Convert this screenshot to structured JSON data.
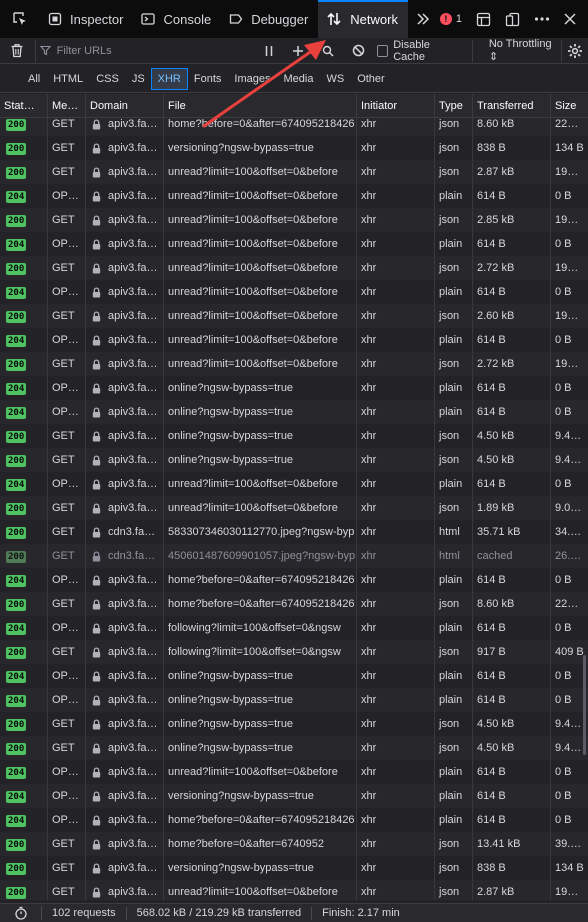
{
  "toolbar": {
    "tabs": [
      {
        "label": "Inspector",
        "icon": "inspector-icon"
      },
      {
        "label": "Console",
        "icon": "console-icon"
      },
      {
        "label": "Debugger",
        "icon": "debugger-icon"
      },
      {
        "label": "Network",
        "icon": "network-icon"
      }
    ],
    "active_tab": "Network",
    "error_count": "1",
    "accent": "#0a84ff"
  },
  "filterbar": {
    "filter_placeholder": "Filter URLs",
    "disable_cache_label": "Disable Cache",
    "throttling_label": "No Throttling ⇕"
  },
  "type_tabs": [
    "All",
    "HTML",
    "CSS",
    "JS",
    "XHR",
    "Fonts",
    "Images",
    "Media",
    "WS",
    "Other"
  ],
  "active_type_tab": "XHR",
  "table": {
    "columns": [
      "Stat…",
      "Me…",
      "Domain",
      "File",
      "Initiator",
      "Type",
      "Transferred",
      "Size"
    ],
    "rows": [
      {
        "status": "200",
        "method": "GET",
        "domain": "apiv3.fa…",
        "file": "home?before=0&after=674095218426",
        "initiator": "xhr",
        "type": "json",
        "transferred": "8.60 kB",
        "size": "22…"
      },
      {
        "status": "200",
        "method": "GET",
        "domain": "apiv3.fa…",
        "file": "versioning?ngsw-bypass=true",
        "initiator": "xhr",
        "type": "json",
        "transferred": "838 B",
        "size": "134 B"
      },
      {
        "status": "200",
        "method": "GET",
        "domain": "apiv3.fa…",
        "file": "unread?limit=100&offset=0&before",
        "initiator": "xhr",
        "type": "json",
        "transferred": "2.87 kB",
        "size": "19…"
      },
      {
        "status": "204",
        "method": "OP…",
        "domain": "apiv3.fa…",
        "file": "unread?limit=100&offset=0&before",
        "initiator": "xhr",
        "type": "plain",
        "transferred": "614 B",
        "size": "0 B"
      },
      {
        "status": "200",
        "method": "GET",
        "domain": "apiv3.fa…",
        "file": "unread?limit=100&offset=0&before",
        "initiator": "xhr",
        "type": "json",
        "transferred": "2.85 kB",
        "size": "19…"
      },
      {
        "status": "204",
        "method": "OP…",
        "domain": "apiv3.fa…",
        "file": "unread?limit=100&offset=0&before",
        "initiator": "xhr",
        "type": "plain",
        "transferred": "614 B",
        "size": "0 B"
      },
      {
        "status": "200",
        "method": "GET",
        "domain": "apiv3.fa…",
        "file": "unread?limit=100&offset=0&before",
        "initiator": "xhr",
        "type": "json",
        "transferred": "2.72 kB",
        "size": "19…"
      },
      {
        "status": "204",
        "method": "OP…",
        "domain": "apiv3.fa…",
        "file": "unread?limit=100&offset=0&before",
        "initiator": "xhr",
        "type": "plain",
        "transferred": "614 B",
        "size": "0 B"
      },
      {
        "status": "200",
        "method": "GET",
        "domain": "apiv3.fa…",
        "file": "unread?limit=100&offset=0&before",
        "initiator": "xhr",
        "type": "json",
        "transferred": "2.60 kB",
        "size": "19…"
      },
      {
        "status": "204",
        "method": "OP…",
        "domain": "apiv3.fa…",
        "file": "unread?limit=100&offset=0&before",
        "initiator": "xhr",
        "type": "plain",
        "transferred": "614 B",
        "size": "0 B"
      },
      {
        "status": "200",
        "method": "GET",
        "domain": "apiv3.fa…",
        "file": "unread?limit=100&offset=0&before",
        "initiator": "xhr",
        "type": "json",
        "transferred": "2.72 kB",
        "size": "19…"
      },
      {
        "status": "204",
        "method": "OP…",
        "domain": "apiv3.fa…",
        "file": "online?ngsw-bypass=true",
        "initiator": "xhr",
        "type": "plain",
        "transferred": "614 B",
        "size": "0 B"
      },
      {
        "status": "204",
        "method": "OP…",
        "domain": "apiv3.fa…",
        "file": "online?ngsw-bypass=true",
        "initiator": "xhr",
        "type": "plain",
        "transferred": "614 B",
        "size": "0 B"
      },
      {
        "status": "200",
        "method": "GET",
        "domain": "apiv3.fa…",
        "file": "online?ngsw-bypass=true",
        "initiator": "xhr",
        "type": "json",
        "transferred": "4.50 kB",
        "size": "9.4…"
      },
      {
        "status": "200",
        "method": "GET",
        "domain": "apiv3.fa…",
        "file": "online?ngsw-bypass=true",
        "initiator": "xhr",
        "type": "json",
        "transferred": "4.50 kB",
        "size": "9.4…"
      },
      {
        "status": "204",
        "method": "OP…",
        "domain": "apiv3.fa…",
        "file": "unread?limit=100&offset=0&before",
        "initiator": "xhr",
        "type": "plain",
        "transferred": "614 B",
        "size": "0 B"
      },
      {
        "status": "200",
        "method": "GET",
        "domain": "apiv3.fa…",
        "file": "unread?limit=100&offset=0&before",
        "initiator": "xhr",
        "type": "json",
        "transferred": "1.89 kB",
        "size": "9.0…"
      },
      {
        "status": "200",
        "method": "GET",
        "domain": "cdn3.fa…",
        "file": "583307346030112770.jpeg?ngsw-byp",
        "initiator": "xhr",
        "type": "html",
        "transferred": "35.71 kB",
        "size": "34.…"
      },
      {
        "status": "200",
        "method": "GET",
        "domain": "cdn3.fa…",
        "file": "450601487609901057.jpeg?ngsw-byp",
        "initiator": "xhr",
        "type": "html",
        "transferred": "cached",
        "size": "26.…",
        "cached": true
      },
      {
        "status": "204",
        "method": "OP…",
        "domain": "apiv3.fa…",
        "file": "home?before=0&after=674095218426",
        "initiator": "xhr",
        "type": "plain",
        "transferred": "614 B",
        "size": "0 B"
      },
      {
        "status": "200",
        "method": "GET",
        "domain": "apiv3.fa…",
        "file": "home?before=0&after=674095218426",
        "initiator": "xhr",
        "type": "json",
        "transferred": "8.60 kB",
        "size": "22…"
      },
      {
        "status": "204",
        "method": "OP…",
        "domain": "apiv3.fa…",
        "file": "following?limit=100&offset=0&ngsw",
        "initiator": "xhr",
        "type": "plain",
        "transferred": "614 B",
        "size": "0 B"
      },
      {
        "status": "200",
        "method": "GET",
        "domain": "apiv3.fa…",
        "file": "following?limit=100&offset=0&ngsw",
        "initiator": "xhr",
        "type": "json",
        "transferred": "917 B",
        "size": "409 B"
      },
      {
        "status": "204",
        "method": "OP…",
        "domain": "apiv3.fa…",
        "file": "online?ngsw-bypass=true",
        "initiator": "xhr",
        "type": "plain",
        "transferred": "614 B",
        "size": "0 B"
      },
      {
        "status": "204",
        "method": "OP…",
        "domain": "apiv3.fa…",
        "file": "online?ngsw-bypass=true",
        "initiator": "xhr",
        "type": "plain",
        "transferred": "614 B",
        "size": "0 B"
      },
      {
        "status": "200",
        "method": "GET",
        "domain": "apiv3.fa…",
        "file": "online?ngsw-bypass=true",
        "initiator": "xhr",
        "type": "json",
        "transferred": "4.50 kB",
        "size": "9.4…"
      },
      {
        "status": "200",
        "method": "GET",
        "domain": "apiv3.fa…",
        "file": "online?ngsw-bypass=true",
        "initiator": "xhr",
        "type": "json",
        "transferred": "4.50 kB",
        "size": "9.4…"
      },
      {
        "status": "204",
        "method": "OP…",
        "domain": "apiv3.fa…",
        "file": "unread?limit=100&offset=0&before",
        "initiator": "xhr",
        "type": "plain",
        "transferred": "614 B",
        "size": "0 B"
      },
      {
        "status": "204",
        "method": "OP…",
        "domain": "apiv3.fa…",
        "file": "versioning?ngsw-bypass=true",
        "initiator": "xhr",
        "type": "plain",
        "transferred": "614 B",
        "size": "0 B"
      },
      {
        "status": "204",
        "method": "OP…",
        "domain": "apiv3.fa…",
        "file": "home?before=0&after=674095218426",
        "initiator": "xhr",
        "type": "plain",
        "transferred": "614 B",
        "size": "0 B"
      },
      {
        "status": "200",
        "method": "GET",
        "domain": "apiv3.fa…",
        "file": "home?before=0&after=6740952",
        "initiator": "xhr",
        "type": "json",
        "transferred": "13.41 kB",
        "size": "39.…"
      },
      {
        "status": "200",
        "method": "GET",
        "domain": "apiv3.fa…",
        "file": "versioning?ngsw-bypass=true",
        "initiator": "xhr",
        "type": "json",
        "transferred": "838 B",
        "size": "134 B"
      },
      {
        "status": "200",
        "method": "GET",
        "domain": "apiv3.fa…",
        "file": "unread?limit=100&offset=0&before",
        "initiator": "xhr",
        "type": "json",
        "transferred": "2.87 kB",
        "size": "19…"
      }
    ]
  },
  "statusbar": {
    "requests": "102 requests",
    "transferred": "568.02 kB / 219.29 kB transferred",
    "finish": "Finish: 2.17 min"
  },
  "colors": {
    "status_ok": "#4ec360",
    "annotation_arrow": "#e8403c"
  }
}
